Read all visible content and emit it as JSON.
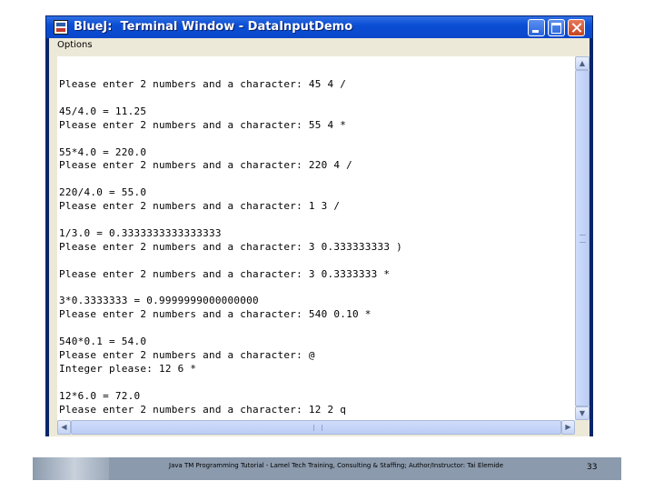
{
  "window": {
    "title": "BlueJ:  Terminal Window - DataInputDemo",
    "menu": [
      "Options"
    ]
  },
  "terminal": {
    "lines": [
      "Please enter 2 numbers and a character: 45 4 /",
      "",
      "45/4.0 = 11.25",
      "Please enter 2 numbers and a character: 55 4 *",
      "",
      "55*4.0 = 220.0",
      "Please enter 2 numbers and a character: 220 4 /",
      "",
      "220/4.0 = 55.0",
      "Please enter 2 numbers and a character: 1 3 /",
      "",
      "1/3.0 = 0.3333333333333333",
      "Please enter 2 numbers and a character: 3 0.333333333 )",
      "",
      "Please enter 2 numbers and a character: 3 0.3333333 *",
      "",
      "3*0.3333333 = 0.9999999000000000",
      "Please enter 2 numbers and a character: 540 0.10 *",
      "",
      "540*0.1 = 54.0",
      "Please enter 2 numbers and a character: @",
      "Integer please: 12 6 *",
      "",
      "12*6.0 = 72.0",
      "Please enter 2 numbers and a character: 12 2 q"
    ]
  },
  "footer": {
    "text": "Java TM Programming Tutorial - Lamel Tech Training, Consulting & Staffing; Author/Instructor: Tai Elemide",
    "page_number": "33"
  },
  "icons": {
    "app": "bluej-app-icon",
    "minimize": "minimize-icon",
    "maximize": "maximize-icon",
    "close": "close-icon"
  }
}
